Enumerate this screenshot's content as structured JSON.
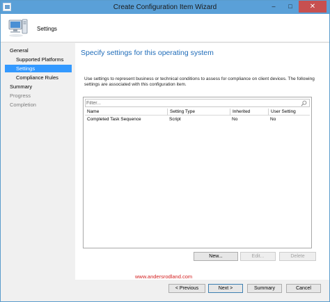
{
  "window": {
    "title": "Create Configuration Item Wizard",
    "minimize": "–",
    "maximize": "□",
    "close": "✕",
    "accent": "#5aa0d8"
  },
  "header": {
    "title": "Settings"
  },
  "nav": {
    "items": [
      {
        "label": "General",
        "state": "normal"
      },
      {
        "label": "Supported Platforms",
        "state": "normal"
      },
      {
        "label": "Settings",
        "state": "selected"
      },
      {
        "label": "Compliance Rules",
        "state": "normal"
      },
      {
        "label": "Summary",
        "state": "normal"
      },
      {
        "label": "Progress",
        "state": "disabled"
      },
      {
        "label": "Completion",
        "state": "disabled"
      }
    ]
  },
  "content": {
    "title": "Specify settings for this operating system",
    "description": "Use settings to represent business or technical conditions to assess for compliance on client devices. The following settings are associated with this configuration item."
  },
  "grid": {
    "filter_placeholder": "Filter...",
    "columns": [
      "Name",
      "Setting Type",
      "Inherited",
      "User Setting"
    ],
    "rows": [
      [
        "Completed Task Sequence",
        "Script",
        "No",
        "No"
      ]
    ]
  },
  "grid_buttons": {
    "new": "New...",
    "edit": "Edit...",
    "delete": "Delete"
  },
  "footer": {
    "watermark": "www.andersrodland.com",
    "previous": "< Previous",
    "next": "Next >",
    "summary": "Summary",
    "cancel": "Cancel"
  }
}
